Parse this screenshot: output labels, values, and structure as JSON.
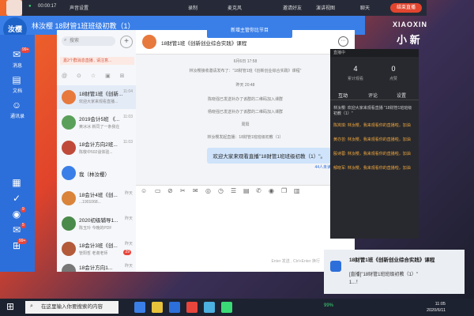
{
  "sharebar": {
    "timer": "00:00:17",
    "items": [
      "声音设置",
      "录制",
      "麦克风",
      "邀请好友",
      "演讲视图",
      "聊天"
    ],
    "end_label": "结束直播"
  },
  "titlebar": {
    "avatar_text": "汝樱",
    "title": "林汝樱 18财管1班班级初教（1）"
  },
  "leftnav": {
    "items": [
      {
        "label": "消息",
        "badge": "99+"
      },
      {
        "label": "文档",
        "badge": ""
      },
      {
        "label": "通讯录",
        "badge": ""
      }
    ],
    "dock_badges": [
      "9",
      "5",
      "99+"
    ]
  },
  "contacts": {
    "search_placeholder": "搜索",
    "plus": "+",
    "banner": "嘉2个群消息直播 , 请注意...",
    "filters": "@ ⊙ ☆ ▣ ⊞",
    "items": [
      {
        "name": "18财管1班《创新...",
        "preview": "欢迎大家来观看直播...",
        "time": "11:04",
        "badge": "",
        "color": "#e7793d"
      },
      {
        "name": "2019会计5班 《...",
        "preview": "黄冰冰 新同了一条我在",
        "time": "11:03",
        "badge": "",
        "color": "#5aa05a"
      },
      {
        "name": "18会计方向2班...",
        "preview": "陈敬中502谈体验...",
        "time": "11:03",
        "badge": "",
        "color": "#c04a3a"
      },
      {
        "name": "我（林汝樱）",
        "preview": "",
        "time": "",
        "badge": "",
        "color": "#3a7fe8"
      },
      {
        "name": "18会计4班《创...",
        "preview": "...1901068...",
        "time": "昨天",
        "badge": "",
        "color": "#d9843a"
      },
      {
        "name": "2020初级辅导1...",
        "preview": "陈玉玲 今晚的PDF",
        "time": "昨天",
        "badge": "",
        "color": "#4a8a4a"
      },
      {
        "name": "18会计3班《创...",
        "preview": "管阳哲 老谢老师",
        "time": "昨天",
        "badge": "29",
        "color": "#b35a3a"
      },
      {
        "name": "18会计方向1...",
        "preview": "",
        "time": "昨天",
        "badge": "",
        "color": "#777"
      }
    ]
  },
  "tooltip": "新增主管你比节目",
  "chat": {
    "title": "18财管1班《创新创业综合实践》课程",
    "system": [
      "6月6日 17:58",
      "林汝樱接收邀请发布了：\"18财管1班《创新创业综合实践》课程\"",
      "昨天 20:48",
      "陈晓强已发送补办了该群的二维码加入课群",
      "杨晓强已发送补办了该群的二维码加入课群",
      "周阳",
      "林汝樱发起直播：18财管1班班级初教（1）"
    ],
    "bubble": "欢迎大家来观看直播\"18财管1班班级初教（1）\"。",
    "me_avatar": "汝樱",
    "read_count": "44人未读",
    "tools": [
      "☺",
      "▭",
      "⊘",
      "✂",
      "✉",
      "◎",
      "◷",
      "☰",
      "▤",
      "✆",
      "◉",
      "❐",
      "▥"
    ],
    "input_hint": "Enter 发送 , Ctrl+Enter 换行",
    "send_label": "发送"
  },
  "live": {
    "header": "直播中",
    "stats": [
      {
        "value": "4",
        "label": "累计观看"
      },
      {
        "value": "0",
        "label": "点赞"
      }
    ],
    "tabs": [
      "互动",
      "评论",
      "设置"
    ],
    "messages": [
      "林汝樱: 欢迎大家来观看直播 \"18财管1班班级初教（1）\"",
      "陈岚琪: 林汝樱，我来观看你的直播啦，加油",
      "黄亦芸: 林汝樱，我来观看你的直播啦，加油",
      "殷诗蓉: 林汝樱，我来观看你的直播啦，加油",
      "郁晓军: 林汝樱，我来观看你的直播啦，加油"
    ]
  },
  "notification": {
    "title": "18财管1班《创新创业综合实践》课程",
    "body": "[直播]\"18财管1班班级初教（1）\"",
    "sub": "1...！"
  },
  "logo": {
    "line1": "XIAOXIN",
    "line2": "小 新"
  },
  "taskbar": {
    "search_placeholder": "在这里输入你要搜索的内容",
    "time": "11:05",
    "date": "2020/6/11",
    "battery": "99%"
  }
}
